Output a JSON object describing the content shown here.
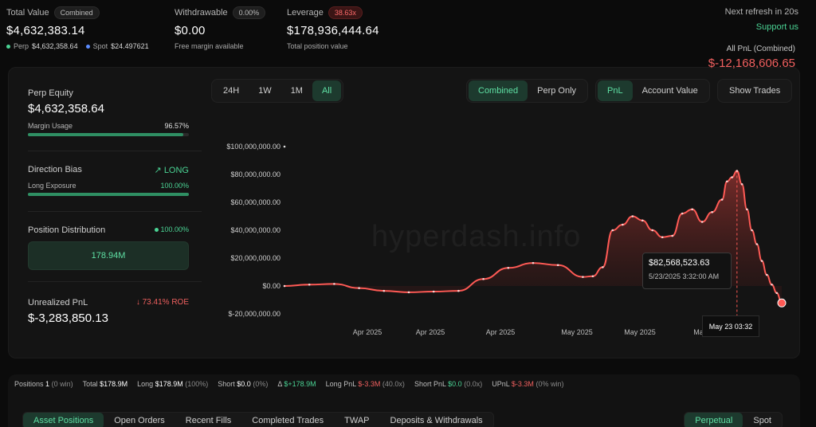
{
  "summary": {
    "total_value": {
      "label": "Total Value",
      "pill": "Combined",
      "value": "$4,632,383.14",
      "perp_label": "Perp",
      "perp_value": "$4,632,358.64",
      "spot_label": "Spot",
      "spot_value": "$24.497621"
    },
    "withdrawable": {
      "label": "Withdrawable",
      "pill": "0.00%",
      "value": "$0.00",
      "sub": "Free margin available"
    },
    "leverage": {
      "label": "Leverage",
      "pill": "38.63x",
      "value": "$178,936,444.64",
      "sub": "Total position value"
    },
    "refresh": "Next refresh in 20s",
    "support": "Support us"
  },
  "left": {
    "perp_equity_label": "Perp Equity",
    "perp_equity": "$4,632,358.64",
    "margin_usage_label": "Margin Usage",
    "margin_usage": "96.57%",
    "margin_usage_fraction": 0.9657,
    "direction_label": "Direction Bias",
    "direction_value": "LONG",
    "long_exposure_label": "Long Exposure",
    "long_exposure": "100.00%",
    "long_exposure_fraction": 1.0,
    "dist_label": "Position Distribution",
    "dist_value": "100.00%",
    "dist_box": "178.94M",
    "upnl_label": "Unrealized PnL",
    "roe": "73.41% ROE",
    "upnl": "$-3,283,850.13"
  },
  "toolbar": {
    "ranges": [
      "24H",
      "1W",
      "1M",
      "All"
    ],
    "mode": [
      "Combined",
      "Perp Only"
    ],
    "metric": [
      "PnL",
      "Account Value"
    ],
    "show_trades": "Show Trades"
  },
  "chart_data": {
    "type": "area",
    "title": "All PnL (Combined)",
    "headline_value": "$-12,168,606.65",
    "y_ticks": [
      "$100,000,000.00",
      "$80,000,000.00",
      "$60,000,000.00",
      "$40,000,000.00",
      "$20,000,000.00",
      "$0.00",
      "$-20,000,000.00"
    ],
    "ylim": [
      -20000000,
      100000000
    ],
    "x_ticks": [
      "Apr 2025",
      "Apr 2025",
      "Apr 2025",
      "May 2025",
      "May 2025",
      "May 2025"
    ],
    "xlim": [
      0,
      100
    ],
    "series": [
      {
        "x": [
          0,
          5,
          10,
          15,
          20,
          25,
          30,
          35,
          40,
          45,
          50,
          55,
          60,
          62,
          64,
          66,
          68,
          70,
          72,
          74,
          76,
          78,
          80,
          82,
          84,
          86,
          88,
          89,
          90,
          91,
          92,
          93,
          94,
          95,
          96,
          97,
          98,
          99,
          100
        ],
        "y": [
          0,
          1000000,
          1500000,
          -1500000,
          -3500000,
          -4500000,
          -4000000,
          -3500000,
          5000000,
          13000000,
          16500000,
          15000000,
          6500000,
          7000000,
          13500000,
          40000000,
          44000000,
          50000000,
          47000000,
          40000000,
          35000000,
          36000000,
          52000000,
          55000000,
          46000000,
          53000000,
          62000000,
          75000000,
          78000000,
          82568523,
          73000000,
          55000000,
          40000000,
          30000000,
          18000000,
          8000000,
          1000000,
          -5000000,
          -12168606
        ]
      }
    ],
    "tooltip_value": "$82,568,523.63",
    "tooltip_time": "5/23/2025 3:32:00 AM",
    "crosshair_label": "May 23 03:32",
    "watermark": "hyperdash.info"
  },
  "footer": {
    "positions_label": "Positions",
    "positions_value": "1",
    "positions_note": "(0 win)",
    "total_label": "Total",
    "total_value": "$178.9M",
    "long_label": "Long",
    "long_value": "$178.9M",
    "long_note": "(100%)",
    "short_label": "Short",
    "short_value": "$0.0",
    "short_note": "(0%)",
    "delta_label": "Δ",
    "delta_value": "$+178.9M",
    "longpnl_label": "Long PnL",
    "longpnl_value": "$-3.3M",
    "longpnl_note": "(40.0x)",
    "shortpnl_label": "Short PnL",
    "shortpnl_value": "$0.0",
    "shortpnl_note": "(0.0x)",
    "upnl_label": "UPnL",
    "upnl_value": "$-3.3M",
    "upnl_note": "(0% win)",
    "tabs": [
      "Asset Positions",
      "Open Orders",
      "Recent Fills",
      "Completed Trades",
      "TWAP",
      "Deposits & Withdrawals"
    ],
    "tabs2": [
      "Perpetual",
      "Spot"
    ]
  },
  "colors": {
    "accent": "#4ad394",
    "loss": "#f0605f",
    "line": "#ff5a55"
  }
}
